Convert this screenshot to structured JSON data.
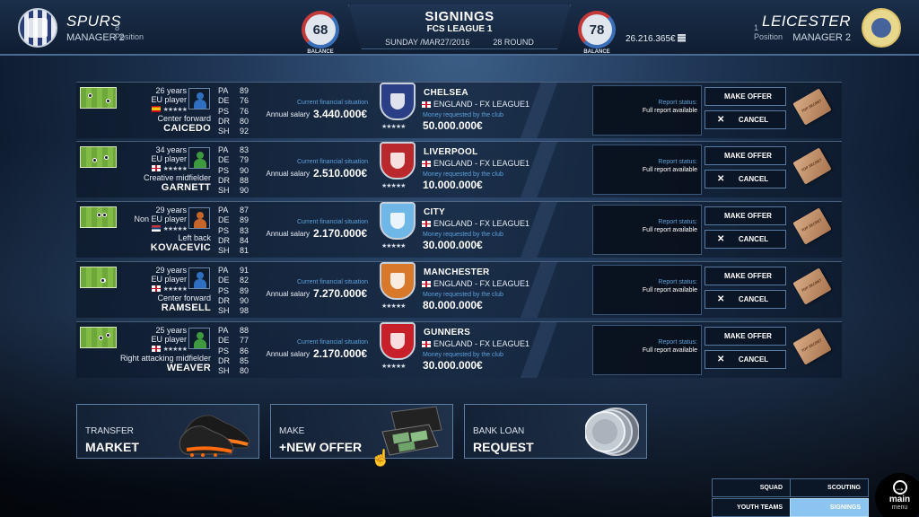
{
  "header": {
    "left_club": {
      "name": "SPURS",
      "position": "8 Position",
      "manager": "MANAGER 2"
    },
    "right_club": {
      "name": "LEICESTER",
      "position": "1 Position",
      "manager": "MANAGER 2"
    },
    "title": "SIGNINGS",
    "league": "FCS LEAGUE 1",
    "date": "SUNDAY /MAR27/2016",
    "round": "28 ROUND",
    "left_balance": "68",
    "right_balance": "78",
    "balance_label": "BALANCE",
    "money": "26.216.365€"
  },
  "labels": {
    "financial": "Current financial situation",
    "salary": "Annual salary",
    "money_requested": "Money requested by the club",
    "report_status": "Report status:",
    "report_value": "Full report available",
    "make_offer": "MAKE OFFER",
    "cancel": "CANCEL",
    "ticket": "TOP SECRET"
  },
  "rows": [
    {
      "age": "26 years",
      "origin": "EU player",
      "stars": "★★★★★",
      "flag": "esp",
      "role": "Center forward",
      "name": "CAICEDO",
      "stats": [
        [
          "PA",
          "89"
        ],
        [
          "DE",
          "76"
        ],
        [
          "PS",
          "76"
        ],
        [
          "DR",
          "80"
        ],
        [
          "SH",
          "92"
        ]
      ],
      "salary": "3.440.000€",
      "club": "CHELSEA",
      "league": "ENGLAND - FX LEAGUE1",
      "club_stars": "★★★★★",
      "requested": "50.000.000€",
      "crest_color": "#2b3f86",
      "avatar_color": "#2f6fc0"
    },
    {
      "age": "34 years",
      "origin": "EU player",
      "stars": "★★★★★",
      "flag": "eng",
      "role": "Creative midfielder",
      "name": "GARNETT",
      "stats": [
        [
          "PA",
          "83"
        ],
        [
          "DE",
          "79"
        ],
        [
          "PS",
          "90"
        ],
        [
          "DR",
          "88"
        ],
        [
          "SH",
          "90"
        ]
      ],
      "salary": "2.510.000€",
      "club": "LIVERPOOL",
      "league": "ENGLAND - FX LEAGUE1",
      "club_stars": "★★★★★",
      "requested": "10.000.000€",
      "crest_color": "#b8282c",
      "avatar_color": "#3e9a3e"
    },
    {
      "age": "29 years",
      "origin": "Non EU player",
      "stars": "★★★★★",
      "flag": "srb",
      "role": "Left back",
      "name": "KOVACEVIC",
      "stats": [
        [
          "PA",
          "87"
        ],
        [
          "DE",
          "89"
        ],
        [
          "PS",
          "83"
        ],
        [
          "DR",
          "84"
        ],
        [
          "SH",
          "81"
        ]
      ],
      "salary": "2.170.000€",
      "club": "CITY",
      "league": "ENGLAND - FX LEAGUE1",
      "club_stars": "★★★★★",
      "requested": "30.000.000€",
      "crest_color": "#6fb7e6",
      "avatar_color": "#c5652a"
    },
    {
      "age": "29 years",
      "origin": "EU player",
      "stars": "★★★★★",
      "flag": "eng",
      "role": "Center forward",
      "name": "RAMSELL",
      "stats": [
        [
          "PA",
          "91"
        ],
        [
          "DE",
          "82"
        ],
        [
          "PS",
          "89"
        ],
        [
          "DR",
          "90"
        ],
        [
          "SH",
          "98"
        ]
      ],
      "salary": "7.270.000€",
      "club": "MANCHESTER",
      "league": "ENGLAND - FX LEAGUE1",
      "club_stars": "★★★★★",
      "requested": "80.000.000€",
      "crest_color": "#d8782a",
      "avatar_color": "#2f6fc0"
    },
    {
      "age": "25 years",
      "origin": "EU player",
      "stars": "★★★★★",
      "flag": "eng",
      "role": "Right attacking midfielder",
      "name": "WEAVER",
      "stats": [
        [
          "PA",
          "88"
        ],
        [
          "DE",
          "77"
        ],
        [
          "PS",
          "86"
        ],
        [
          "DR",
          "85"
        ],
        [
          "SH",
          "80"
        ]
      ],
      "salary": "2.170.000€",
      "club": "GUNNERS",
      "league": "ENGLAND - FX LEAGUE1",
      "club_stars": "★★★★★",
      "requested": "30.000.000€",
      "crest_color": "#c8202a",
      "avatar_color": "#3e9a3e"
    }
  ],
  "big_buttons": [
    {
      "top": "TRANSFER",
      "bottom": "MARKET",
      "icon": "boots-icon"
    },
    {
      "top": "MAKE",
      "bottom": "+NEW OFFER",
      "icon": "briefcase-money-icon"
    },
    {
      "top": "BANK LOAN",
      "bottom": "REQUEST",
      "icon": "coins-icon"
    }
  ],
  "nav": {
    "squad": "SQUAD",
    "scouting": "SCOUTING",
    "youth": "YOUTH TEAMS",
    "signings": "SIGNINGS",
    "main": "main",
    "menu": "menu"
  }
}
